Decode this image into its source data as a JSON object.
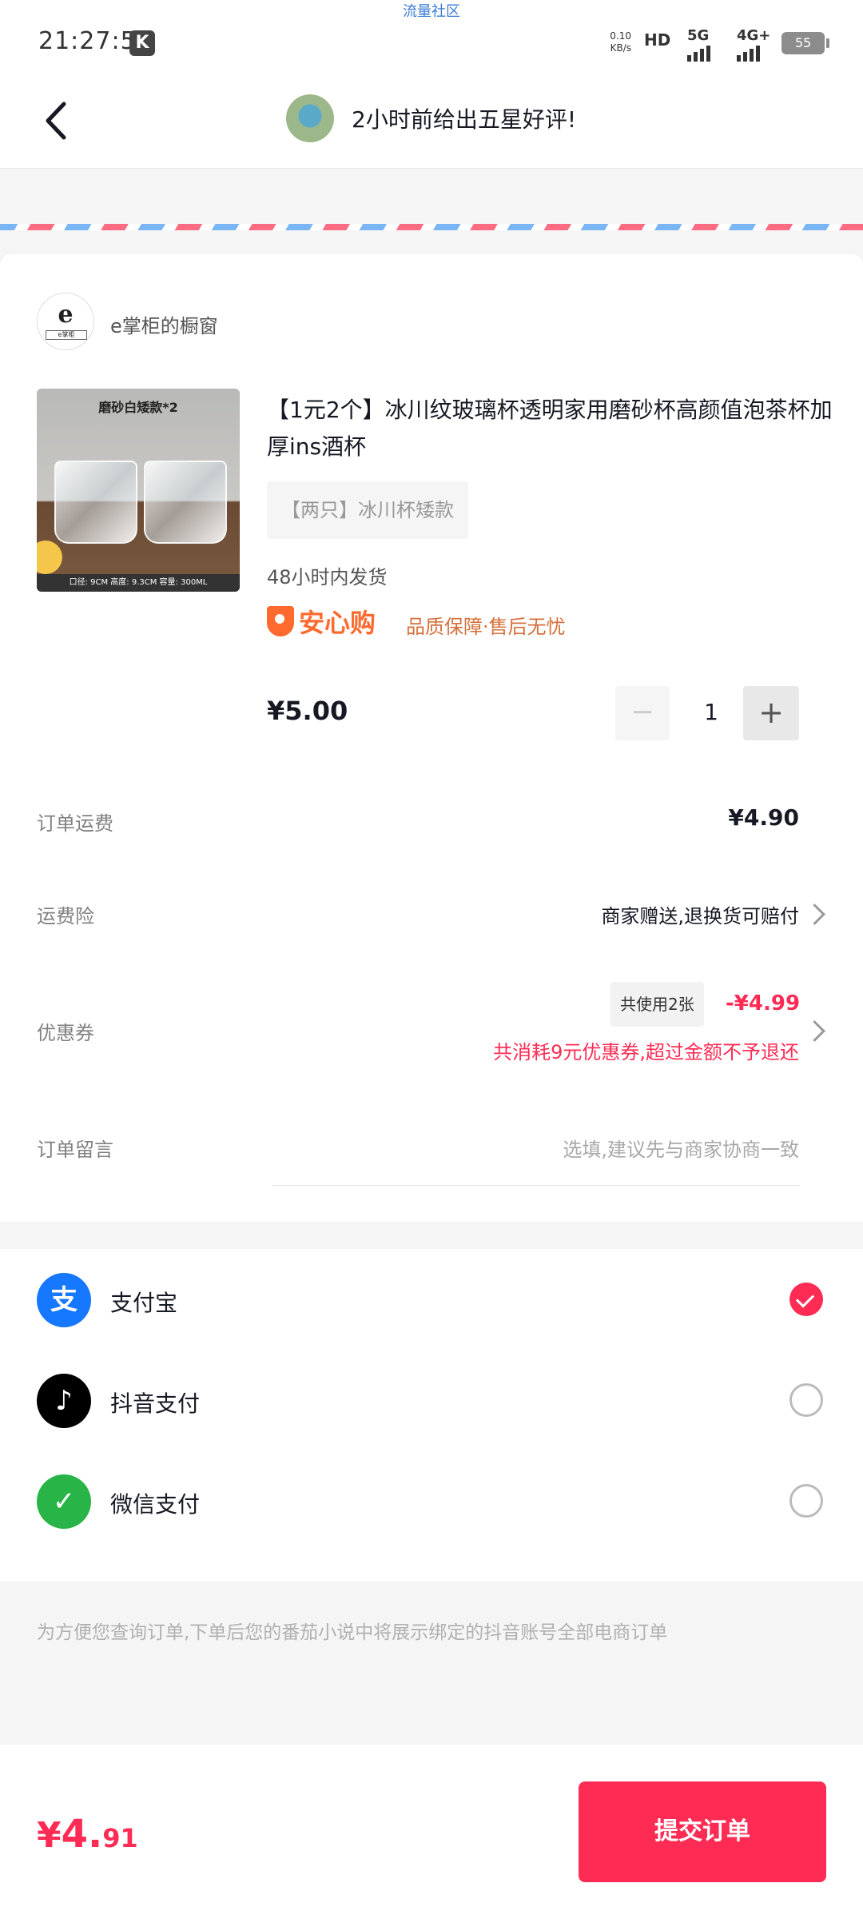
{
  "status_bar": {
    "time": "21:27:53",
    "app_badge": "K",
    "center_label": "流量社区",
    "net_speed_value": "0.10",
    "net_speed_unit": "KB/s",
    "hd_label": "HD",
    "sim1_label": "5G",
    "sim2_label": "4G+",
    "battery": "55"
  },
  "header": {
    "title": "2小时前给出五星好评!"
  },
  "shop": {
    "logo_letter": "e",
    "logo_sub": "e掌柜",
    "name": "e掌柜的橱窗"
  },
  "product": {
    "image_label": "磨砂白矮款*2",
    "image_dims": "口径: 9CM   高度: 9.3CM   容量: 300ML",
    "title": "【1元2个】冰川纹玻璃杯透明家用磨砂杯高颜值泡茶杯加厚ins酒杯",
    "sku": "【两只】冰川杯矮款",
    "shipping": "48小时内发货",
    "guarantee_brand": "安心购",
    "guarantee_text": "品质保障·售后无忧",
    "price": "¥5.00",
    "qty_minus": "−",
    "quantity": "1",
    "qty_plus": "+"
  },
  "order_rows": {
    "freight_label": "订单运费",
    "freight_value": "¥4.90",
    "insurance_label": "运费险",
    "insurance_value": "商家赠送,退换货可赔付",
    "coupon_label": "优惠券",
    "coupon_badge": "共使用2张",
    "coupon_amount": "-¥4.99",
    "coupon_note": "共消耗9元优惠券,超过金额不予退还",
    "remark_label": "订单留言",
    "remark_placeholder": "选填,建议先与商家协商一致"
  },
  "payment": {
    "options": [
      {
        "label": "支付宝",
        "icon": "alipay-icon",
        "icon_char": "支",
        "color": "#1677ff",
        "selected": true
      },
      {
        "label": "抖音支付",
        "icon": "douyin-pay-icon",
        "icon_char": "♪",
        "color": "#000000",
        "selected": false
      },
      {
        "label": "微信支付",
        "icon": "wechat-pay-icon",
        "icon_char": "✓",
        "color": "#28b446",
        "selected": false
      }
    ]
  },
  "notice": "为方便您查询订单,下单后您的番茄小说中将展示绑定的抖音账号全部电商订单",
  "footer": {
    "total_yen": "¥",
    "total_int": "4.",
    "total_dec": "91",
    "submit_label": "提交订单"
  },
  "colors": {
    "accent": "#fe2c55",
    "guarantee": "#ff6a2e"
  }
}
